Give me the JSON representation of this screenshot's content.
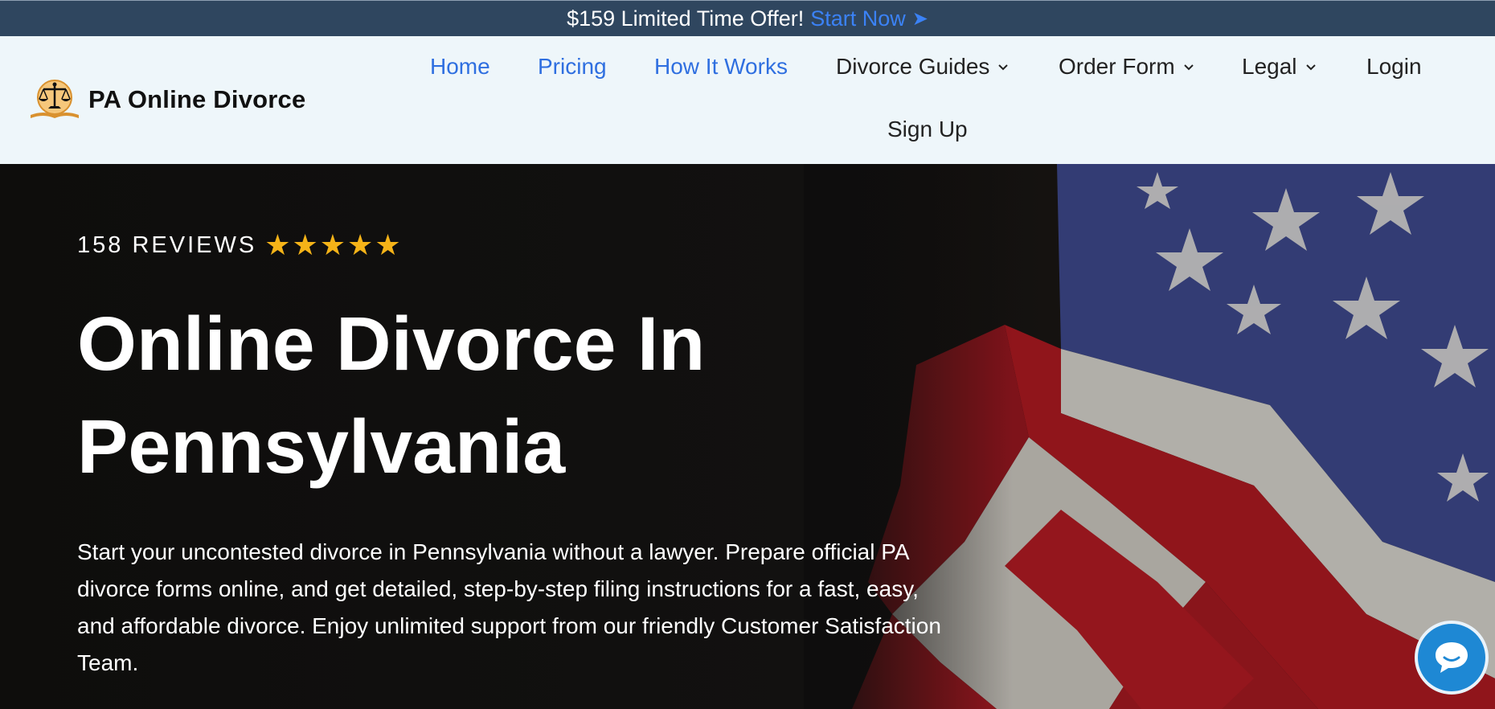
{
  "announcement": {
    "text": "$159 Limited Time Offer!",
    "cta_label": "Start Now",
    "arrow_icon": "arrow-right-icon"
  },
  "header": {
    "logo_text": "PA Online Divorce",
    "logo_icon": "scales-of-justice-icon",
    "nav": [
      {
        "label": "Home",
        "active_color": "#2f6fe0"
      },
      {
        "label": "Pricing"
      },
      {
        "label": "How It Works"
      },
      {
        "label": "Divorce Guides",
        "dropdown": true
      },
      {
        "label": "Order Form",
        "dropdown": true
      },
      {
        "label": "Legal",
        "dropdown": true
      },
      {
        "label": "Login"
      },
      {
        "label": "Sign Up"
      }
    ]
  },
  "hero": {
    "reviews_label": "158 REVIEWS",
    "rating_stars": 5,
    "star_glyphs": [
      "★",
      "★",
      "★",
      "★",
      "★"
    ],
    "headline_line1": "Online Divorce In",
    "headline_line2": "Pennsylvania",
    "description": "Start your uncontested divorce in Pennsylvania without a lawyer. Prepare official PA divorce forms online, and get detailed, step-by-step filing instructions for a fast, easy, and affordable divorce. Enjoy unlimited support from our friendly Customer Satisfaction Team."
  },
  "chat_widget": {
    "icon": "chat-bubble-icon"
  },
  "colors": {
    "topbar_bg": "#2f465f",
    "header_bg": "#eef6fa",
    "link_blue": "#2f6fe0",
    "star_gold": "#f5b318",
    "chat_blue": "#1e88d4"
  }
}
